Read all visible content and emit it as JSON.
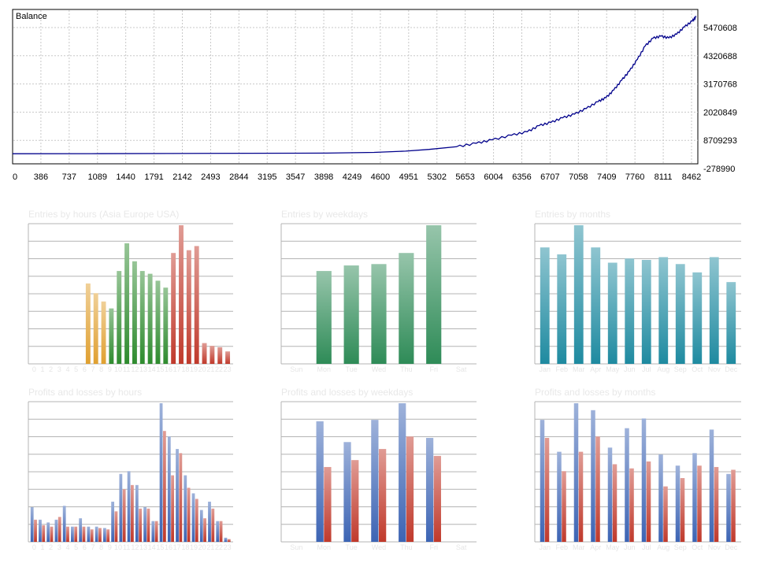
{
  "balance": {
    "title": "Balance",
    "colors": {
      "line": "#00008b",
      "grid": "#c8c8c8",
      "frame": "#000000"
    },
    "chart_data": {
      "type": "line",
      "title": "Balance",
      "x_ticks": [
        "0",
        "386",
        "737",
        "1089",
        "1440",
        "1791",
        "2142",
        "2493",
        "2844",
        "3195",
        "3547",
        "3898",
        "4249",
        "4600",
        "4951",
        "5302",
        "5653",
        "6004",
        "6356",
        "6707",
        "7058",
        "7409",
        "7760",
        "8111",
        "8462"
      ],
      "y_ticks": [
        "5470608",
        "4320688",
        "3170768",
        "2020849",
        "8709293",
        "-278990"
      ],
      "xlim": [
        0,
        8700
      ],
      "ylim": [
        -278990,
        5700000
      ],
      "x": [
        0,
        1000,
        2000,
        3000,
        4000,
        4600,
        5000,
        5300,
        5650,
        5900,
        6100,
        6350,
        6550,
        6700,
        6850,
        7000,
        7150,
        7300,
        7450,
        7550,
        7650,
        7750,
        7850,
        7950,
        8050,
        8150,
        8250,
        8350,
        8450,
        8550,
        8650,
        8700
      ],
      "y": [
        5000,
        8000,
        15000,
        22000,
        30000,
        60000,
        110000,
        180000,
        290000,
        430000,
        570000,
        760000,
        900000,
        1150000,
        1280000,
        1470000,
        1620000,
        1850000,
        2130000,
        2290000,
        2600000,
        3000000,
        3380000,
        3850000,
        4400000,
        4720000,
        4800000,
        4730000,
        4880000,
        5180000,
        5420000,
        5600000
      ]
    }
  },
  "panels": [
    {
      "id": "entries-hours",
      "title": "Entries by hours (Asia Europe USA)",
      "chart_data": {
        "type": "bar",
        "title": "Entries by hours (Asia Europe USA)",
        "categories": [
          "0",
          "1",
          "2",
          "3",
          "4",
          "5",
          "6",
          "7",
          "8",
          "9",
          "10",
          "11",
          "12",
          "13",
          "14",
          "15",
          "16",
          "17",
          "18",
          "19",
          "20",
          "21",
          "22",
          "23"
        ],
        "values": [
          0,
          0,
          0,
          0,
          0,
          0,
          0,
          58,
          51,
          45,
          40,
          67,
          87,
          74,
          67,
          65,
          60,
          55,
          80,
          100,
          82,
          85,
          15,
          13,
          12,
          9
        ],
        "ylim": [
          0,
          100
        ],
        "colors_by_range": [
          {
            "from": 0,
            "to": 9,
            "color": "#e0a030"
          },
          {
            "from": 10,
            "to": 17,
            "color": "#2e8b2e"
          },
          {
            "from": 18,
            "to": 25,
            "color": "#c0392b"
          }
        ]
      }
    },
    {
      "id": "entries-weekdays",
      "title": "Entries by weekdays",
      "chart_data": {
        "type": "bar",
        "title": "Entries by weekdays",
        "categories": [
          "Sun",
          "Mon",
          "Tue",
          "Wed",
          "Thu",
          "Fri",
          "Sat"
        ],
        "values": [
          0,
          67,
          71,
          72,
          80,
          100,
          0
        ],
        "ylim": [
          0,
          100
        ],
        "color": "#2e8b57"
      }
    },
    {
      "id": "entries-months",
      "title": "Entries by months",
      "chart_data": {
        "type": "bar",
        "title": "Entries by months",
        "categories": [
          "Jan",
          "Feb",
          "Mar",
          "Apr",
          "May",
          "Jun",
          "Jul",
          "Aug",
          "Sep",
          "Oct",
          "Nov",
          "Dec"
        ],
        "values": [
          84,
          79,
          100,
          84,
          73,
          76,
          75,
          77,
          72,
          66,
          77,
          59
        ],
        "ylim": [
          0,
          100
        ],
        "color": "#1e8aa0"
      }
    },
    {
      "id": "pl-hours",
      "title": "Profits and losses by hours",
      "chart_data": {
        "type": "bar",
        "title": "Profits and losses by hours",
        "categories": [
          "0",
          "1",
          "2",
          "3",
          "4",
          "5",
          "6",
          "7",
          "8",
          "9",
          "10",
          "11",
          "12",
          "13",
          "14",
          "15",
          "16",
          "17",
          "18",
          "19",
          "20",
          "21",
          "22",
          "23"
        ],
        "series": [
          {
            "color": "#3c64b4",
            "values": [
              25,
              16,
              14,
              16,
              26,
              11,
              17,
              11,
              11,
              10,
              29,
              49,
              51,
              41,
              25,
              15,
              100,
              76,
              67,
              48,
              35,
              23,
              29,
              15,
              3
            ]
          },
          {
            "color": "#c0392b",
            "values": [
              16,
              12,
              11,
              18,
              11,
              11,
              11,
              9,
              10,
              9,
              22,
              38,
              41,
              24,
              24,
              15,
              80,
              48,
              64,
              39,
              31,
              17,
              24,
              15,
              2
            ]
          }
        ],
        "ylim": [
          0,
          100
        ]
      }
    },
    {
      "id": "pl-weekdays",
      "title": "Profits and losses by weekdays",
      "chart_data": {
        "type": "bar",
        "title": "Profits and losses by weekdays",
        "categories": [
          "Sun",
          "Mon",
          "Tue",
          "Wed",
          "Thu",
          "Fri",
          "Sat"
        ],
        "series": [
          {
            "color": "#3c64b4",
            "values": [
              0,
              87,
              72,
              88,
              100,
              75,
              0
            ]
          },
          {
            "color": "#c0392b",
            "values": [
              0,
              54,
              59,
              67,
              76,
              62,
              0
            ]
          }
        ],
        "ylim": [
          0,
          100
        ]
      }
    },
    {
      "id": "pl-months",
      "title": "Profits and losses by months",
      "chart_data": {
        "type": "bar",
        "title": "Profits and losses by months",
        "categories": [
          "Jan",
          "Feb",
          "Mar",
          "Apr",
          "May",
          "Jun",
          "Jul",
          "Aug",
          "Sep",
          "Oct",
          "Nov",
          "Dec"
        ],
        "series": [
          {
            "color": "#3c64b4",
            "values": [
              88,
              65,
              100,
              95,
              68,
              82,
              89,
              63,
              55,
              64,
              81,
              49
            ]
          },
          {
            "color": "#c0392b",
            "values": [
              75,
              51,
              65,
              76,
              56,
              53,
              58,
              40,
              46,
              55,
              54,
              52
            ]
          }
        ],
        "ylim": [
          0,
          100
        ]
      }
    }
  ]
}
